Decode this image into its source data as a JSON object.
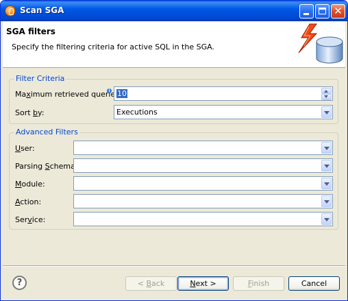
{
  "window": {
    "title": "Scan SGA"
  },
  "header": {
    "title": "SGA filters",
    "description": "Specify the filtering criteria for active SQL in the SGA."
  },
  "filter_criteria": {
    "legend": "Filter Criteria",
    "max_queries": {
      "label_pre": "Ma",
      "label_u": "x",
      "label_post": "imum retrieved queries:",
      "value": "10"
    },
    "sort_by": {
      "label_pre": "Sort ",
      "label_u": "b",
      "label_post": "y:",
      "value": "Executions"
    }
  },
  "advanced_filters": {
    "legend": "Advanced Filters",
    "user": {
      "label_u": "U",
      "label_post": "ser:",
      "value": ""
    },
    "parsing_schema": {
      "label_pre": "Parsing ",
      "label_u": "S",
      "label_post": "chema:",
      "value": ""
    },
    "module": {
      "label_u": "M",
      "label_post": "odule:",
      "value": ""
    },
    "action": {
      "label_u": "A",
      "label_post": "ction:",
      "value": ""
    },
    "service": {
      "label_pre": "Ser",
      "label_u": "v",
      "label_post": "ice:",
      "value": ""
    }
  },
  "buttons": {
    "back_pre": "< ",
    "back_u": "B",
    "back_post": "ack",
    "next_u": "N",
    "next_post": "ext >",
    "finish_u": "F",
    "finish_post": "inish",
    "cancel": "Cancel",
    "help_glyph": "?"
  },
  "icons": {
    "app": "eclipse-db-icon",
    "header_image": "database-lightning-icon",
    "help": "help-icon",
    "info": "info-icon"
  },
  "colors": {
    "titlebar": "#0058e6",
    "legend": "#0046d5",
    "selection": "#316ac5"
  }
}
